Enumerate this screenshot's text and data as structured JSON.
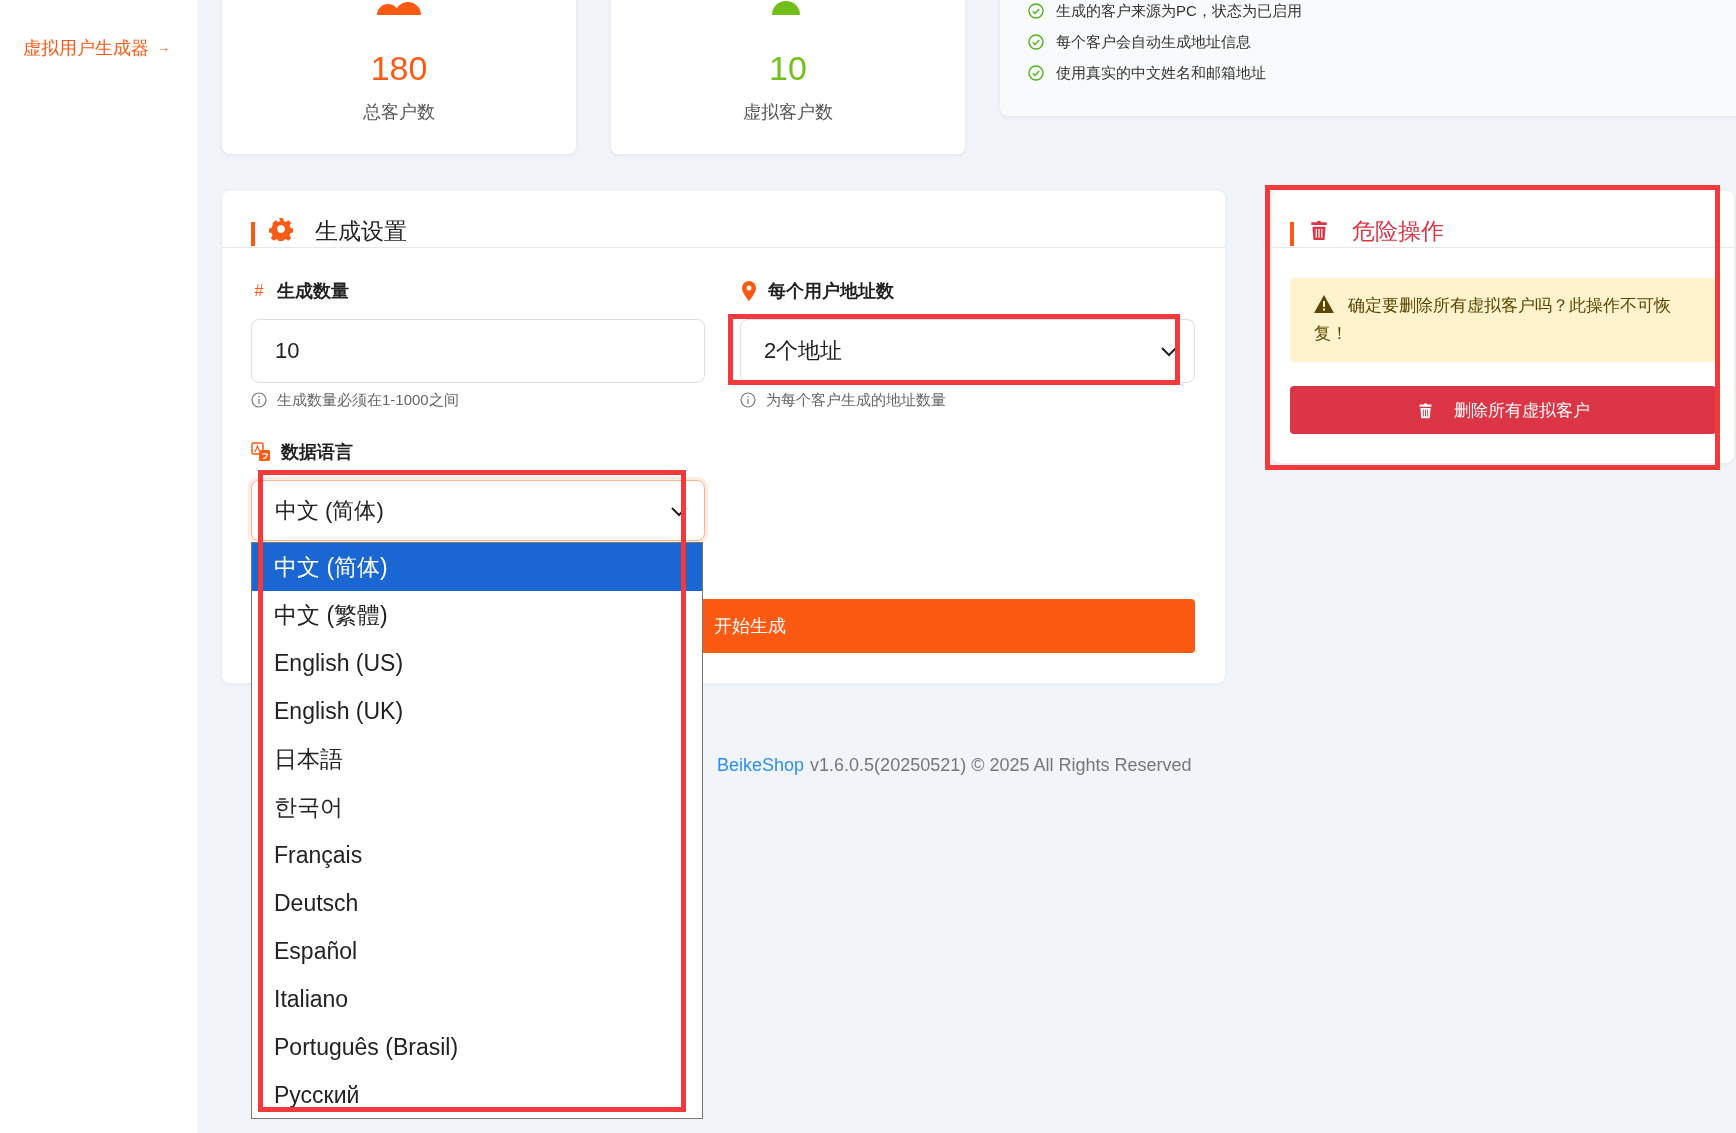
{
  "sidebar": {
    "link": {
      "label": "虚拟用户生成器",
      "arrow": "→"
    }
  },
  "stats": [
    {
      "value": "180",
      "label": "总客户数",
      "color": "#fc5a12"
    },
    {
      "value": "10",
      "label": "虚拟客户数",
      "color": "#72bf1b"
    }
  ],
  "notes": [
    "生成的客户来源为PC，状态为已启用",
    "每个客户会自动生成地址信息",
    "使用真实的中文姓名和邮箱地址"
  ],
  "settings": {
    "title": "生成设置",
    "quantity": {
      "icon": "#",
      "label": "生成数量",
      "value": "10",
      "hint": "生成数量必须在1-1000之间"
    },
    "address": {
      "label": "每个用户地址数",
      "value": "2个地址",
      "hint": "为每个客户生成的地址数量",
      "highlighted": true
    },
    "language": {
      "label": "数据语言",
      "value": "中文 (简体)",
      "highlighted": true,
      "expanded": true,
      "options": [
        {
          "label": "中文 (简体)",
          "selected": true
        },
        {
          "label": "中文 (繁體)",
          "selected": false
        },
        {
          "label": "English (US)",
          "selected": false
        },
        {
          "label": "English (UK)",
          "selected": false
        },
        {
          "label": "日本語",
          "selected": false
        },
        {
          "label": "한국어",
          "selected": false
        },
        {
          "label": "Français",
          "selected": false
        },
        {
          "label": "Deutsch",
          "selected": false
        },
        {
          "label": "Español",
          "selected": false
        },
        {
          "label": "Italiano",
          "selected": false
        },
        {
          "label": "Português (Brasil)",
          "selected": false
        },
        {
          "label": "Русский",
          "selected": false
        }
      ]
    },
    "start_button": "开始生成"
  },
  "danger": {
    "title": "危险操作",
    "warning": "确定要删除所有虚拟客户吗？此操作不可恢复！",
    "button": "删除所有虚拟客户",
    "highlighted": true
  },
  "footer": {
    "brand": "BeikeShop",
    "text": "v1.6.0.5(20250521) © 2025 All Rights Reserved"
  }
}
